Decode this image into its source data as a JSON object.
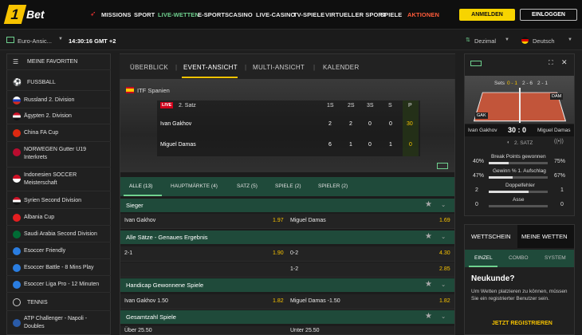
{
  "brand": {
    "logo_one": "1",
    "logo_bet": "Bet"
  },
  "nav": {
    "items": [
      "MISSIONS",
      "SPORT",
      "LIVE-WETTEN",
      "E-SPORTS",
      "CASINO",
      "LIVE-CASINO",
      "TV-SPIELE",
      "VIRTUELLER SPORT",
      "SPIELE",
      "AKTIONEN"
    ],
    "register": "ANMELDEN",
    "login": "EINLOGGEN"
  },
  "subbar": {
    "odds_format": "Euro-Ansic...",
    "time": "14:30:16 GMT +2",
    "decimal": "Dezimal",
    "language": "Deutsch"
  },
  "sidebar": {
    "favorites": "MEINE FAVORITEN",
    "football": "FUSSBALL",
    "items": [
      "Russland 2. Division",
      "Ägypten 2. Division",
      "China FA Cup",
      "NORWEGEN Gutter U19 Interkrets",
      "Indonesien SOCCER Meisterschaft",
      "Syrien Second Division",
      "Albania Cup",
      "Saudi Arabia Second Division",
      "Esoccer Friendly",
      "Esoccer Battle - 8 Mins Play",
      "Esoccer Liga Pro - 12 Minuten"
    ],
    "tennis": "TENNIS",
    "tennis_item": "ATP Challenger - Napoli - Doubles"
  },
  "center": {
    "tabs": [
      "ÜBERBLICK",
      "EVENT-ANSICHT",
      "MULTI-ANSICHT",
      "KALENDER"
    ],
    "league": "ITF Spanien",
    "live": "LIVE",
    "set_label": "2. Satz",
    "cols": [
      "1S",
      "2S",
      "3S",
      "S",
      "P"
    ],
    "p1": {
      "name": "Ivan Gakhov",
      "s": [
        "2",
        "2",
        "0",
        "0",
        "30"
      ]
    },
    "p2": {
      "name": "Miguel Damas",
      "s": [
        "6",
        "1",
        "0",
        "1",
        "0"
      ]
    },
    "market_tabs": [
      "ALLE (13)",
      "HAUPTMÄRKTE (4)",
      "SATZ (5)",
      "SPIELE (2)",
      "SPIELER (2)"
    ],
    "m1": "Sieger",
    "m1a": "Ivan Gakhov",
    "m1av": "1.97",
    "m1b": "Miguel Damas",
    "m1bv": "1.69",
    "m2": "Alle Sätze - Genaues Ergebnis",
    "m2a": "2-1",
    "m2av": "1.90",
    "m2b": "0-2",
    "m2bv": "4.30",
    "m2c": "1-2",
    "m2cv": "2.85",
    "m3": "Handicap Gewonnene Spiele",
    "m3a": "Ivan Gakhov  1.50",
    "m3av": "1.82",
    "m3b": "Miguel Damas  -1.50",
    "m3bv": "1.82",
    "m4": "Gesamtzahl Spiele",
    "m4a": "Über  25.50",
    "m4b": "Unter  25.50"
  },
  "widget": {
    "sets_label": "Sets",
    "sets": [
      "0 - 1",
      "2 - 6",
      "2 - 1"
    ],
    "gak": "GAK",
    "dam": "DAM",
    "p1": "Ivan Gakhov",
    "p2": "Miguel Damas",
    "score": "30 : 0",
    "satz": "2. SATZ",
    "s1l": "Break Points gewonnen",
    "s1a": "40%",
    "s1b": "75%",
    "s2l": "Gewinn % 1. Aufschlag",
    "s2a": "47%",
    "s2b": "67%",
    "s3l": "Doppelfehler",
    "s3a": "2",
    "s3b": "1",
    "s4l": "Asse",
    "s4a": "0",
    "s4b": "0"
  },
  "wett": {
    "tab1": "WETTSCHEIN",
    "tab2": "MEINE WETTEN",
    "sub": [
      "EINZEL",
      "COMBO",
      "SYSTEM"
    ],
    "title": "Neukunde?",
    "text": "Um Wetten platzieren zu können, müssen Sie ein registrierter Benutzer sein.",
    "cta": "JETZT REGISTRIEREN"
  }
}
